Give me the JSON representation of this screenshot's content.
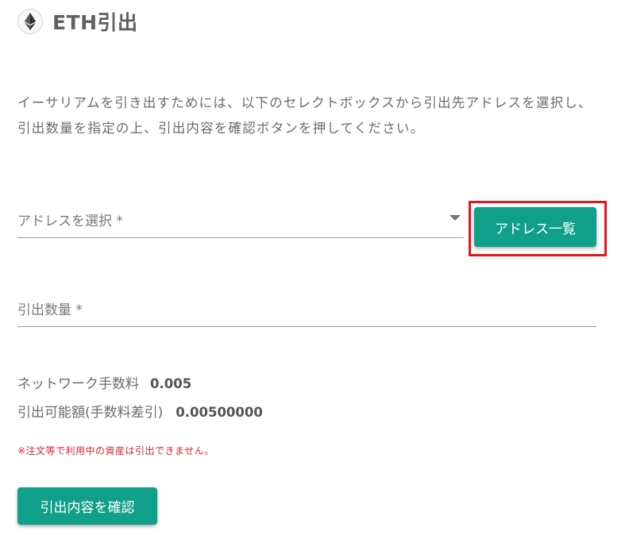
{
  "header": {
    "icon": "ethereum-icon",
    "title": "ETH引出"
  },
  "description": "イーサリアムを引き出すためには、以下のセレクトボックスから引出先アドレスを選択し、引出数量を指定の上、引出内容を確認ボタンを押してください。",
  "address_select": {
    "label": "アドレスを選択 *",
    "selected_value": ""
  },
  "address_list_button": {
    "label": "アドレス一覧"
  },
  "amount_field": {
    "label": "引出数量 *",
    "value": ""
  },
  "info": {
    "fee_label": "ネットワーク手数料",
    "fee_value": "0.005",
    "available_label": "引出可能額(手数料差引)",
    "available_value": "0.00500000"
  },
  "notice": "※注文等で利用中の資産は引出できません。",
  "confirm_button": {
    "label": "引出内容を確認"
  },
  "colors": {
    "accent": "#10a08a",
    "highlight": "#e8141c",
    "notice": "#d9262b"
  }
}
